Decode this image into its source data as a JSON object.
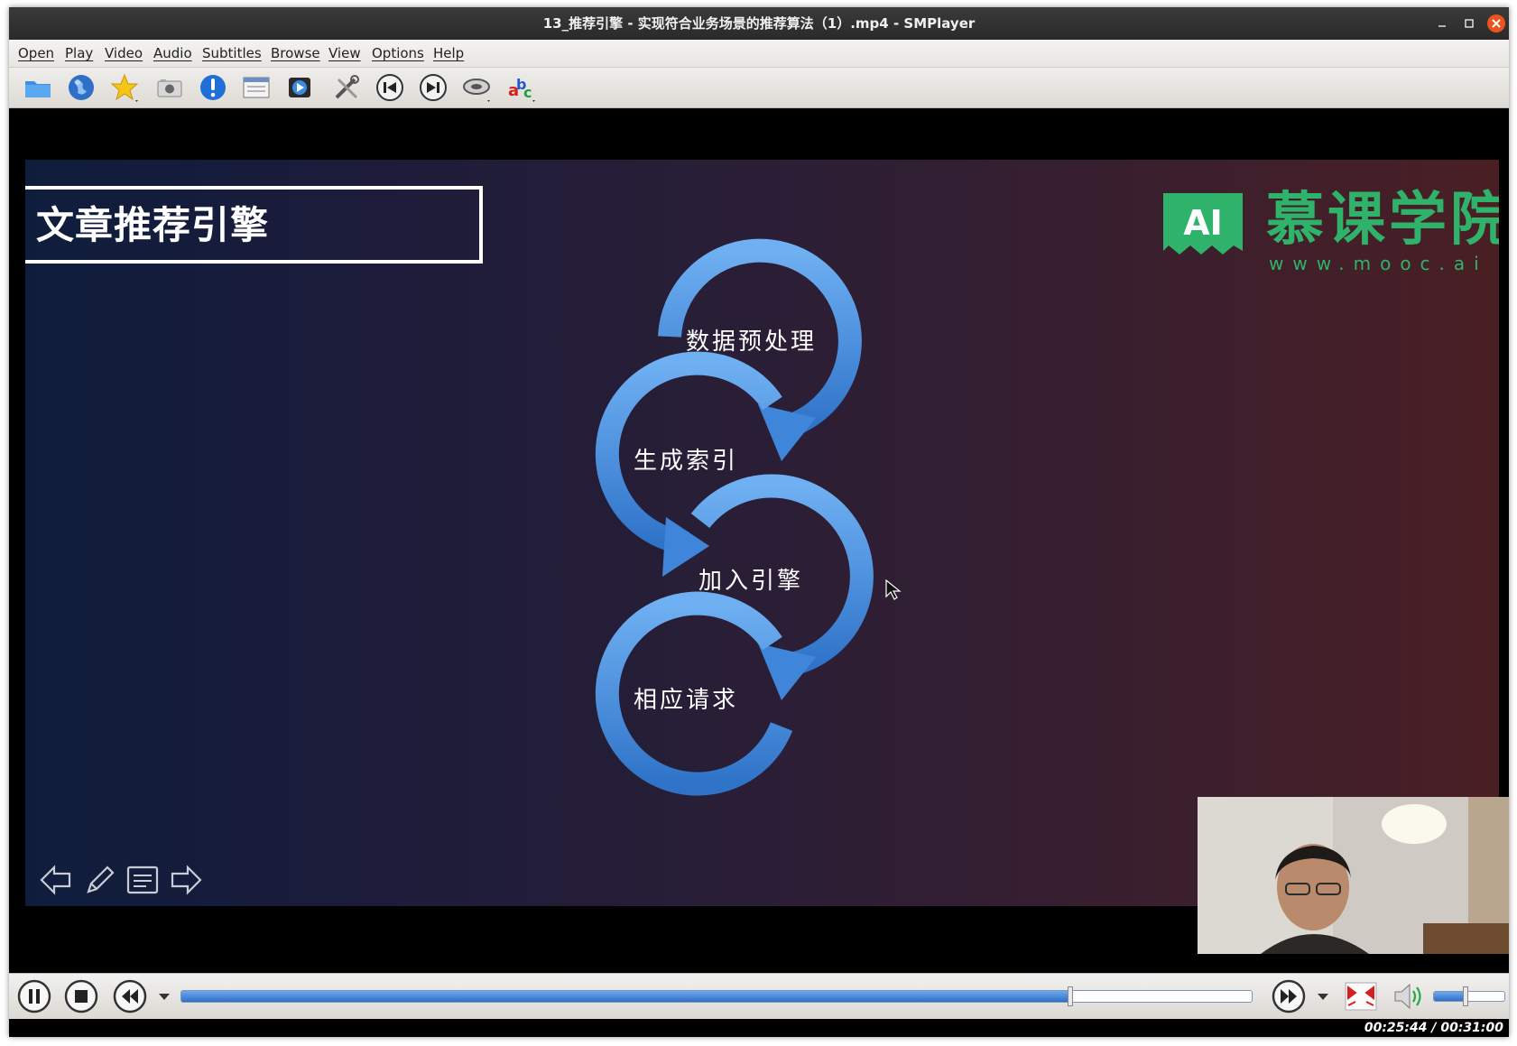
{
  "window": {
    "title": "13_推荐引擎 - 实现符合业务场景的推荐算法（1）.mp4 - SMPlayer",
    "controls": [
      "minimize-icon",
      "maximize-icon",
      "close-icon"
    ]
  },
  "menu": [
    "Open",
    "Play",
    "Video",
    "Audio",
    "Subtitles",
    "Browse",
    "View",
    "Options",
    "Help"
  ],
  "toolbar": [
    "open-folder-icon",
    "open-url-globe-icon",
    "favorites-star-icon",
    "screenshot-camera-icon",
    "info-exclamation-icon",
    "playlist-icon",
    "video-preferences-icon",
    "preferences-tools-icon",
    "previous-chapter-icon",
    "next-chapter-icon",
    "audio-track-icon",
    "subtitle-track-icon"
  ],
  "slide": {
    "title": "文章推荐引擎",
    "logo": {
      "mark": "AI",
      "name": "慕课学院",
      "url": "www.mooc.ai"
    },
    "steps": [
      "数据预处理",
      "生成索引",
      "加入引擎",
      "相应请求"
    ],
    "nav": [
      "prev-arrow-icon",
      "pen-icon",
      "notes-icon",
      "next-arrow-icon"
    ]
  },
  "player": {
    "progress": 0.8297,
    "volume": 0.45,
    "time": "00:25:44 / 00:31:00",
    "colors": {
      "accent": "#3a7bd5",
      "close": "#e95420",
      "logo": "#2fb36a"
    }
  }
}
